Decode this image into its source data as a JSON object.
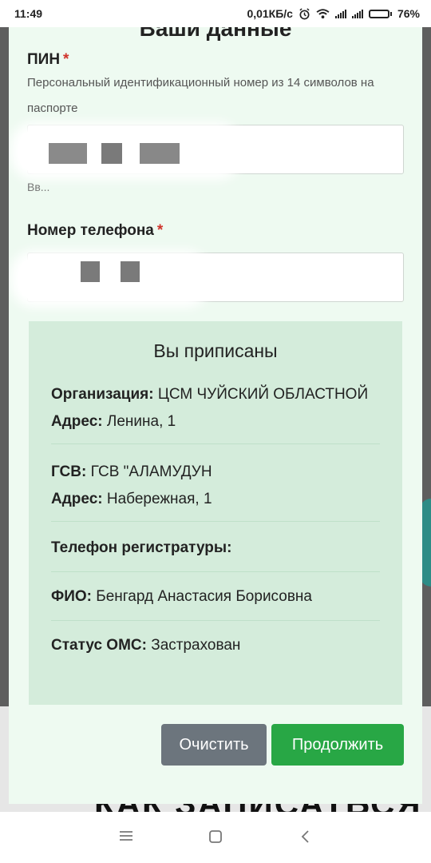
{
  "status_bar": {
    "time": "11:49",
    "speed": "0,01КБ/с",
    "battery": "76%",
    "battery_level": 0.76,
    "icons": [
      "alarm-icon",
      "wifi-icon",
      "signal-icon",
      "signal-icon",
      "battery-icon"
    ]
  },
  "background": {
    "heading": "КАК ЗАПИСАТЬСЯ"
  },
  "modal": {
    "title": "Ваши данные",
    "pin": {
      "label": "ПИН",
      "required_mark": "*",
      "help": "Персональный идентификационный номер из 14 символов на паспорте",
      "hint": "Вв..."
    },
    "phone": {
      "label": "Номер телефона",
      "required_mark": "*"
    },
    "assignment": {
      "title": "Вы приписаны",
      "organization_label": "Организация:",
      "organization_value": "ЦСМ ЧУЙСКИЙ ОБЛАСТНОЙ",
      "org_address_label": "Адрес:",
      "org_address_value": "Ленина, 1",
      "gsv_label": "ГСВ:",
      "gsv_value": "ГСВ \"АЛАМУДУН",
      "gsv_address_label": "Адрес:",
      "gsv_address_value": "Набережная, 1",
      "registry_phone_label": "Телефон регистратуры:",
      "fio_label": "ФИО:",
      "fio_value": "Бенгард Анастасия Борисовна",
      "oms_label": "Статус ОМС:",
      "oms_value": "Застрахован"
    },
    "buttons": {
      "clear": "Очистить",
      "continue": "Продолжить"
    }
  },
  "colors": {
    "modal_bg": "#eefaf1",
    "info_bg": "#d4ecdb",
    "required": "#d0342c",
    "clear_btn": "#6c757d",
    "continue_btn": "#28a745"
  }
}
